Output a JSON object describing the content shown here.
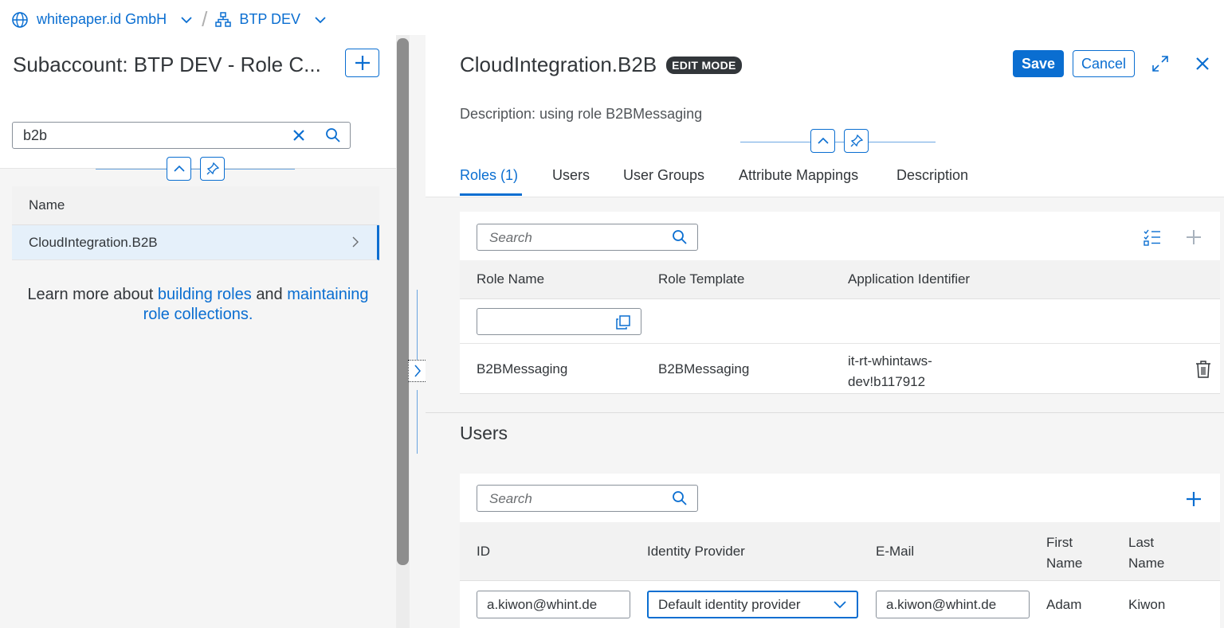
{
  "breadcrumb": {
    "global_account": "whitepaper.id GmbH",
    "separator": "/",
    "subaccount": "BTP DEV"
  },
  "left": {
    "title": "Subaccount: BTP DEV - Role C...",
    "search_value": "b2b",
    "table_header": "Name",
    "rows": [
      "CloudIntegration.B2B"
    ],
    "learn_prefix": "Learn more about",
    "learn_link1": "building roles",
    "learn_and": "and",
    "learn_link2": "maintaining",
    "learn_link2b": "role collections",
    "learn_suffix": "."
  },
  "detail": {
    "title": "CloudIntegration.B2B",
    "mode_badge": "EDIT MODE",
    "save_label": "Save",
    "cancel_label": "Cancel",
    "description": "Description: using role B2BMessaging",
    "tabs": [
      "Roles (1)",
      "Users",
      "User Groups",
      "Attribute Mappings",
      "Description"
    ],
    "active_tab": "Roles (1)"
  },
  "roles": {
    "search_placeholder": "Search",
    "columns": [
      "Role Name",
      "Role Template",
      "Application Identifier"
    ],
    "rows": [
      {
        "role_name": "B2BMessaging",
        "role_template": "B2BMessaging",
        "app_id_line1": "it-rt-whintaws-",
        "app_id_line2": "dev!b117912"
      }
    ]
  },
  "users": {
    "section_title": "Users",
    "search_placeholder": "Search",
    "columns": {
      "id": "ID",
      "idp": "Identity Provider",
      "email": "E-Mail",
      "first_line1": "First",
      "first_line2": "Name",
      "last_line1": "Last",
      "last_line2": "Name"
    },
    "rows": [
      {
        "id": "a.kiwon@whint.de",
        "idp": "Default identity provider",
        "email": "a.kiwon@whint.de",
        "first": "Adam",
        "last": "Kiwon"
      }
    ]
  },
  "colors": {
    "accent": "#0a6ed1",
    "text": "#32363a",
    "badge_bg": "#32363a",
    "background": "#f5f5f5"
  }
}
